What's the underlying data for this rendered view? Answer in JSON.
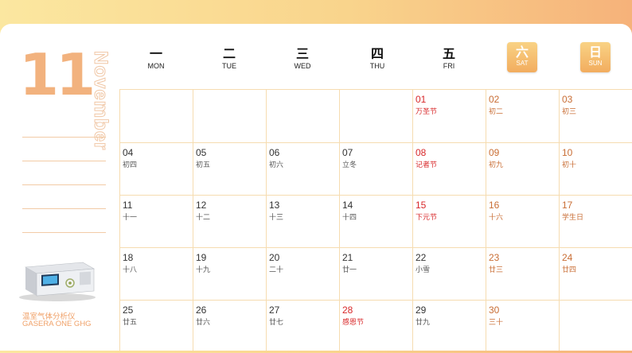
{
  "month": {
    "number": "11",
    "name": "November"
  },
  "product": {
    "name_cn": "温室气体分析仪",
    "name_en": "GASERA ONE GHG"
  },
  "weekdays": [
    {
      "cn": "一",
      "en": "MON"
    },
    {
      "cn": "二",
      "en": "TUE"
    },
    {
      "cn": "三",
      "en": "WED"
    },
    {
      "cn": "四",
      "en": "THU"
    },
    {
      "cn": "五",
      "en": "FRI"
    },
    {
      "cn": "六",
      "en": "SAT"
    },
    {
      "cn": "日",
      "en": "SUN"
    }
  ],
  "weeks": [
    [
      null,
      null,
      null,
      null,
      {
        "day": "01",
        "sub": "万圣节",
        "style": "red"
      },
      {
        "day": "02",
        "sub": "初二",
        "style": "orange"
      },
      {
        "day": "03",
        "sub": "初三",
        "style": "orange"
      }
    ],
    [
      {
        "day": "04",
        "sub": "初四"
      },
      {
        "day": "05",
        "sub": "初五"
      },
      {
        "day": "06",
        "sub": "初六"
      },
      {
        "day": "07",
        "sub": "立冬"
      },
      {
        "day": "08",
        "sub": "记者节",
        "style": "red"
      },
      {
        "day": "09",
        "sub": "初九",
        "style": "orange"
      },
      {
        "day": "10",
        "sub": "初十",
        "style": "orange"
      }
    ],
    [
      {
        "day": "11",
        "sub": "十一"
      },
      {
        "day": "12",
        "sub": "十二"
      },
      {
        "day": "13",
        "sub": "十三"
      },
      {
        "day": "14",
        "sub": "十四"
      },
      {
        "day": "15",
        "sub": "下元节",
        "style": "red"
      },
      {
        "day": "16",
        "sub": "十六",
        "style": "orange"
      },
      {
        "day": "17",
        "sub": "学生日",
        "style": "orange"
      }
    ],
    [
      {
        "day": "18",
        "sub": "十八"
      },
      {
        "day": "19",
        "sub": "十九"
      },
      {
        "day": "20",
        "sub": "二十"
      },
      {
        "day": "21",
        "sub": "廿一"
      },
      {
        "day": "22",
        "sub": "小雪"
      },
      {
        "day": "23",
        "sub": "廿三",
        "style": "orange"
      },
      {
        "day": "24",
        "sub": "廿四",
        "style": "orange"
      }
    ],
    [
      {
        "day": "25",
        "sub": "廿五"
      },
      {
        "day": "26",
        "sub": "廿六"
      },
      {
        "day": "27",
        "sub": "廿七"
      },
      {
        "day": "28",
        "sub": "感恩节",
        "style": "red"
      },
      {
        "day": "29",
        "sub": "廿九"
      },
      {
        "day": "30",
        "sub": "三十",
        "style": "orange"
      },
      null
    ]
  ],
  "colors": {
    "accent": "#f2b27e",
    "holiday": "#d8282a",
    "weekend": "#c96e35",
    "grid": "#f6dcb0"
  }
}
